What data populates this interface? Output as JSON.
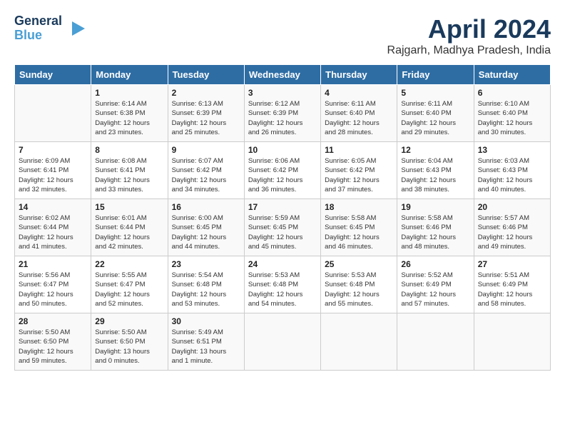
{
  "logo": {
    "line1": "General",
    "line2": "Blue"
  },
  "title": "April 2024",
  "subtitle": "Rajgarh, Madhya Pradesh, India",
  "headers": [
    "Sunday",
    "Monday",
    "Tuesday",
    "Wednesday",
    "Thursday",
    "Friday",
    "Saturday"
  ],
  "weeks": [
    [
      {
        "day": "",
        "detail": ""
      },
      {
        "day": "1",
        "detail": "Sunrise: 6:14 AM\nSunset: 6:38 PM\nDaylight: 12 hours\nand 23 minutes."
      },
      {
        "day": "2",
        "detail": "Sunrise: 6:13 AM\nSunset: 6:39 PM\nDaylight: 12 hours\nand 25 minutes."
      },
      {
        "day": "3",
        "detail": "Sunrise: 6:12 AM\nSunset: 6:39 PM\nDaylight: 12 hours\nand 26 minutes."
      },
      {
        "day": "4",
        "detail": "Sunrise: 6:11 AM\nSunset: 6:40 PM\nDaylight: 12 hours\nand 28 minutes."
      },
      {
        "day": "5",
        "detail": "Sunrise: 6:11 AM\nSunset: 6:40 PM\nDaylight: 12 hours\nand 29 minutes."
      },
      {
        "day": "6",
        "detail": "Sunrise: 6:10 AM\nSunset: 6:40 PM\nDaylight: 12 hours\nand 30 minutes."
      }
    ],
    [
      {
        "day": "7",
        "detail": "Sunrise: 6:09 AM\nSunset: 6:41 PM\nDaylight: 12 hours\nand 32 minutes."
      },
      {
        "day": "8",
        "detail": "Sunrise: 6:08 AM\nSunset: 6:41 PM\nDaylight: 12 hours\nand 33 minutes."
      },
      {
        "day": "9",
        "detail": "Sunrise: 6:07 AM\nSunset: 6:42 PM\nDaylight: 12 hours\nand 34 minutes."
      },
      {
        "day": "10",
        "detail": "Sunrise: 6:06 AM\nSunset: 6:42 PM\nDaylight: 12 hours\nand 36 minutes."
      },
      {
        "day": "11",
        "detail": "Sunrise: 6:05 AM\nSunset: 6:42 PM\nDaylight: 12 hours\nand 37 minutes."
      },
      {
        "day": "12",
        "detail": "Sunrise: 6:04 AM\nSunset: 6:43 PM\nDaylight: 12 hours\nand 38 minutes."
      },
      {
        "day": "13",
        "detail": "Sunrise: 6:03 AM\nSunset: 6:43 PM\nDaylight: 12 hours\nand 40 minutes."
      }
    ],
    [
      {
        "day": "14",
        "detail": "Sunrise: 6:02 AM\nSunset: 6:44 PM\nDaylight: 12 hours\nand 41 minutes."
      },
      {
        "day": "15",
        "detail": "Sunrise: 6:01 AM\nSunset: 6:44 PM\nDaylight: 12 hours\nand 42 minutes."
      },
      {
        "day": "16",
        "detail": "Sunrise: 6:00 AM\nSunset: 6:45 PM\nDaylight: 12 hours\nand 44 minutes."
      },
      {
        "day": "17",
        "detail": "Sunrise: 5:59 AM\nSunset: 6:45 PM\nDaylight: 12 hours\nand 45 minutes."
      },
      {
        "day": "18",
        "detail": "Sunrise: 5:58 AM\nSunset: 6:45 PM\nDaylight: 12 hours\nand 46 minutes."
      },
      {
        "day": "19",
        "detail": "Sunrise: 5:58 AM\nSunset: 6:46 PM\nDaylight: 12 hours\nand 48 minutes."
      },
      {
        "day": "20",
        "detail": "Sunrise: 5:57 AM\nSunset: 6:46 PM\nDaylight: 12 hours\nand 49 minutes."
      }
    ],
    [
      {
        "day": "21",
        "detail": "Sunrise: 5:56 AM\nSunset: 6:47 PM\nDaylight: 12 hours\nand 50 minutes."
      },
      {
        "day": "22",
        "detail": "Sunrise: 5:55 AM\nSunset: 6:47 PM\nDaylight: 12 hours\nand 52 minutes."
      },
      {
        "day": "23",
        "detail": "Sunrise: 5:54 AM\nSunset: 6:48 PM\nDaylight: 12 hours\nand 53 minutes."
      },
      {
        "day": "24",
        "detail": "Sunrise: 5:53 AM\nSunset: 6:48 PM\nDaylight: 12 hours\nand 54 minutes."
      },
      {
        "day": "25",
        "detail": "Sunrise: 5:53 AM\nSunset: 6:48 PM\nDaylight: 12 hours\nand 55 minutes."
      },
      {
        "day": "26",
        "detail": "Sunrise: 5:52 AM\nSunset: 6:49 PM\nDaylight: 12 hours\nand 57 minutes."
      },
      {
        "day": "27",
        "detail": "Sunrise: 5:51 AM\nSunset: 6:49 PM\nDaylight: 12 hours\nand 58 minutes."
      }
    ],
    [
      {
        "day": "28",
        "detail": "Sunrise: 5:50 AM\nSunset: 6:50 PM\nDaylight: 12 hours\nand 59 minutes."
      },
      {
        "day": "29",
        "detail": "Sunrise: 5:50 AM\nSunset: 6:50 PM\nDaylight: 13 hours\nand 0 minutes."
      },
      {
        "day": "30",
        "detail": "Sunrise: 5:49 AM\nSunset: 6:51 PM\nDaylight: 13 hours\nand 1 minute."
      },
      {
        "day": "",
        "detail": ""
      },
      {
        "day": "",
        "detail": ""
      },
      {
        "day": "",
        "detail": ""
      },
      {
        "day": "",
        "detail": ""
      }
    ]
  ]
}
